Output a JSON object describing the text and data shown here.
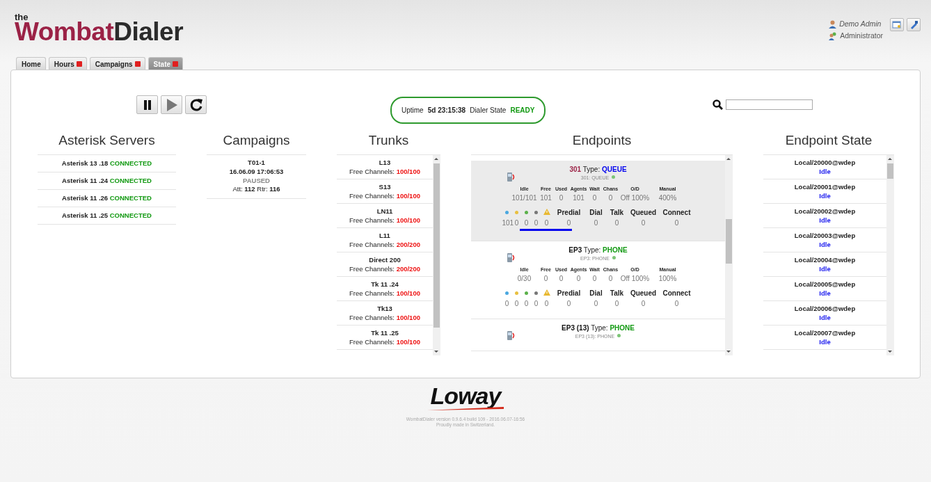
{
  "logo": {
    "small": "the",
    "first": "Wombat",
    "second": "Dialer"
  },
  "user": {
    "name": "Demo Admin",
    "role": "Administrator"
  },
  "tabs": [
    {
      "label": "Home",
      "closable": false,
      "selected": false
    },
    {
      "label": "Hours",
      "closable": true,
      "selected": false
    },
    {
      "label": "Campaigns",
      "closable": true,
      "selected": false
    },
    {
      "label": "State",
      "closable": true,
      "selected": true
    }
  ],
  "status": {
    "uptime_label": "Uptime",
    "uptime": "5d 23:15:38",
    "state_label": "Dialer State",
    "state": "READY"
  },
  "servers": {
    "title": "Asterisk Servers",
    "items": [
      {
        "name": "Asterisk 13 .18",
        "state": "CONNECTED"
      },
      {
        "name": "Asterisk 11 .24",
        "state": "CONNECTED"
      },
      {
        "name": "Asterisk 11 .26",
        "state": "CONNECTED"
      },
      {
        "name": "Asterisk 11 .25",
        "state": "CONNECTED"
      }
    ]
  },
  "campaigns": {
    "title": "Campaigns",
    "items": [
      {
        "name": "T01-1",
        "date": "16.06.09 17:06:53",
        "state": "PAUSED",
        "att_label": "Att:",
        "att": "112",
        "rtr_label": "Rtr:",
        "rtr": "116"
      }
    ]
  },
  "trunks": {
    "title": "Trunks",
    "items": [
      {
        "name": "L13",
        "label": "Free Channels:",
        "value": "100/100"
      },
      {
        "name": "S13",
        "label": "Free Channels:",
        "value": "100/100"
      },
      {
        "name": "LN11",
        "label": "Free Channels:",
        "value": "100/100"
      },
      {
        "name": "L11",
        "label": "Free Channels:",
        "value": "200/200"
      },
      {
        "name": "Direct 200",
        "label": "Free Channels:",
        "value": "200/200"
      },
      {
        "name": "Tk 11 .24",
        "label": "Free Channels:",
        "value": "100/100"
      },
      {
        "name": "Tk13",
        "label": "Free Channels:",
        "value": "100/100"
      },
      {
        "name": "Tk 11 .25",
        "label": "Free Channels:",
        "value": "100/100"
      }
    ]
  },
  "endpoints": {
    "title": "Endpoints",
    "items": [
      {
        "name": "301",
        "type_label": "Type:",
        "type": "QUEUE",
        "color": "#0000ee",
        "subtitle": "301: QUEUE",
        "selected": true,
        "stats_labels": [
          "Idle",
          "Free",
          "Used",
          "Agents",
          "Wait",
          "Chans",
          "O/D",
          "Manual"
        ],
        "stats_values": [
          "101/101",
          "101",
          "0",
          "101",
          "0",
          "0",
          "Off",
          "100%",
          "400%"
        ],
        "call_labels": [
          "Predial",
          "Dial",
          "Talk",
          "Queued",
          "Connect"
        ],
        "call_values": [
          "101",
          "0",
          "0",
          "0",
          "0",
          "0",
          "0",
          "0",
          "0",
          "0"
        ]
      },
      {
        "name": "EP3",
        "type_label": "Type:",
        "type": "PHONE",
        "color": "#119911",
        "subtitle": "EP3: PHONE",
        "selected": false,
        "stats_labels": [
          "Idle",
          "Free",
          "Used",
          "Agents",
          "Wait",
          "Chans",
          "O/D",
          "Manual"
        ],
        "stats_values": [
          "0/30",
          "0",
          "0",
          "0",
          "0",
          "0",
          "Off",
          "100%",
          "100%"
        ],
        "call_labels": [
          "Predial",
          "Dial",
          "Talk",
          "Queued",
          "Connect"
        ],
        "call_values": [
          "0",
          "0",
          "0",
          "0",
          "0",
          "0",
          "0",
          "0",
          "0",
          "0"
        ]
      },
      {
        "name": "EP3 (13)",
        "type_label": "Type:",
        "type": "PHONE",
        "color": "#119911",
        "subtitle": "EP3 (13): PHONE",
        "selected": false
      }
    ]
  },
  "endpoint_state": {
    "title": "Endpoint State",
    "items": [
      {
        "name": "Local/20000@wdep",
        "state": "Idle"
      },
      {
        "name": "Local/20001@wdep",
        "state": "Idle"
      },
      {
        "name": "Local/20002@wdep",
        "state": "Idle"
      },
      {
        "name": "Local/20003@wdep",
        "state": "Idle"
      },
      {
        "name": "Local/20004@wdep",
        "state": "Idle"
      },
      {
        "name": "Local/20005@wdep",
        "state": "Idle"
      },
      {
        "name": "Local/20006@wdep",
        "state": "Idle"
      },
      {
        "name": "Local/20007@wdep",
        "state": "Idle"
      }
    ]
  },
  "footer": {
    "brand": "Loway",
    "version": "WombatDialer version 0.9.6.4 build 109 - 2016.06.07-16:56",
    "tagline": "Proudly made in Switzerland."
  }
}
